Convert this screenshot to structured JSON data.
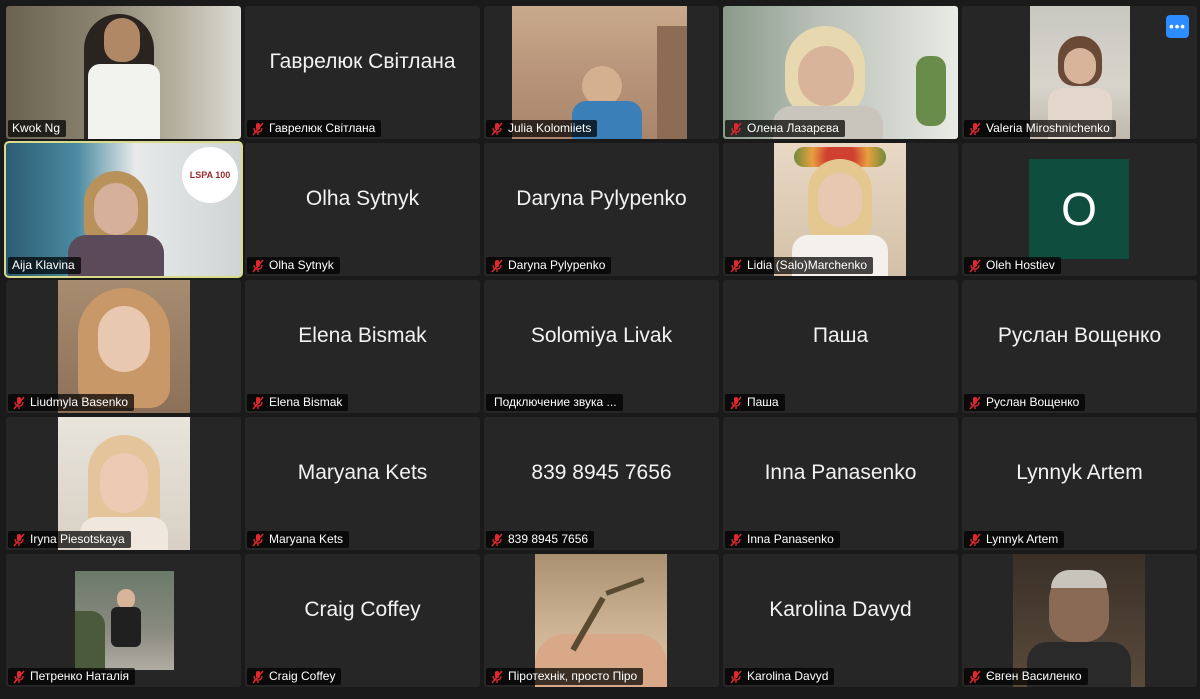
{
  "participants": [
    {
      "name": "Kwok Ng",
      "display": ""
    },
    {
      "name": "Гаврелюк Світлана",
      "display": "Гаврелюк Світлана"
    },
    {
      "name": "Julia Kolomiiets",
      "display": ""
    },
    {
      "name": "Олена Лазарєва",
      "display": ""
    },
    {
      "name": "Valeria Miroshnichenko",
      "display": ""
    },
    {
      "name": "Aija Klavina",
      "display": ""
    },
    {
      "name": "Olha Sytnyk",
      "display": "Olha Sytnyk"
    },
    {
      "name": "Daryna Pylypenko",
      "display": "Daryna Pylypenko"
    },
    {
      "name": "Lidia (Salo)Marchenko",
      "display": ""
    },
    {
      "name": "Oleh Hostiev",
      "display": "",
      "initial": "O"
    },
    {
      "name": "Liudmyla Basenko",
      "display": ""
    },
    {
      "name": "Elena Bismak",
      "display": "Elena Bismak"
    },
    {
      "name": "Подключение звука ...",
      "display": "Solomiya Livak"
    },
    {
      "name": "Паша",
      "display": "Паша"
    },
    {
      "name": "Руслан Вощенко",
      "display": "Руслан Вощенко"
    },
    {
      "name": "Iryna Piesotskaya",
      "display": ""
    },
    {
      "name": "Maryana Kets",
      "display": "Maryana Kets"
    },
    {
      "name": "839 8945 7656",
      "display": "839 8945 7656"
    },
    {
      "name": "Inna Panasenko",
      "display": "Inna Panasenko"
    },
    {
      "name": "Lynnyk Artem",
      "display": "Lynnyk Artem"
    },
    {
      "name": "Петренко Наталія",
      "display": ""
    },
    {
      "name": "Craig Coffey",
      "display": "Craig Coffey"
    },
    {
      "name": "Піротехнік, просто Піро",
      "display": ""
    },
    {
      "name": "Karolina Davyd",
      "display": "Karolina Davyd"
    },
    {
      "name": "Євген Василенко",
      "display": ""
    }
  ],
  "more_button": "•••",
  "logo_text": "LSPA 100"
}
